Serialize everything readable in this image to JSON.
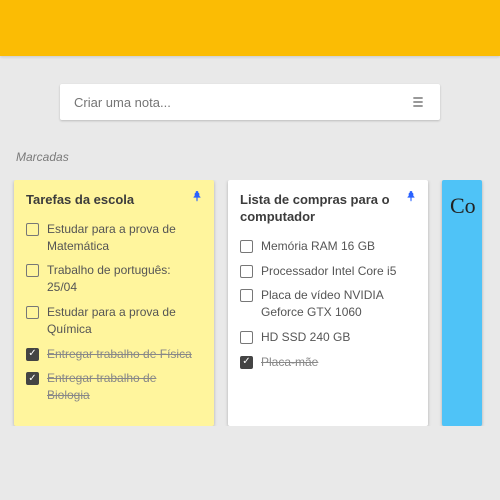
{
  "createNote": {
    "placeholder": "Criar uma nota..."
  },
  "sectionLabel": "Marcadas",
  "notes": [
    {
      "color": "yellow",
      "title": "Tarefas da escola",
      "pinned": true,
      "items": [
        {
          "text": "Estudar para a prova de Matemática",
          "checked": false
        },
        {
          "text": "Trabalho de português: 25/04",
          "checked": false
        },
        {
          "text": "Estudar para a prova de Química",
          "checked": false
        },
        {
          "text": "Entregar trabalho de Física",
          "checked": true
        },
        {
          "text": "Entregar trabalho de Biologia",
          "checked": true
        }
      ]
    },
    {
      "color": "white",
      "title": "Lista de compras para o computador",
      "pinned": true,
      "items": [
        {
          "text": "Memória RAM 16 GB",
          "checked": false
        },
        {
          "text": "Processador Intel Core i5",
          "checked": false
        },
        {
          "text": "Placa de vídeo NVIDIA Geforce GTX 1060",
          "checked": false
        },
        {
          "text": "HD SSD 240 GB",
          "checked": false
        },
        {
          "text": "Placa-mãe",
          "checked": true
        }
      ]
    },
    {
      "color": "blue",
      "title": "Co",
      "pinned": false,
      "items": []
    }
  ]
}
